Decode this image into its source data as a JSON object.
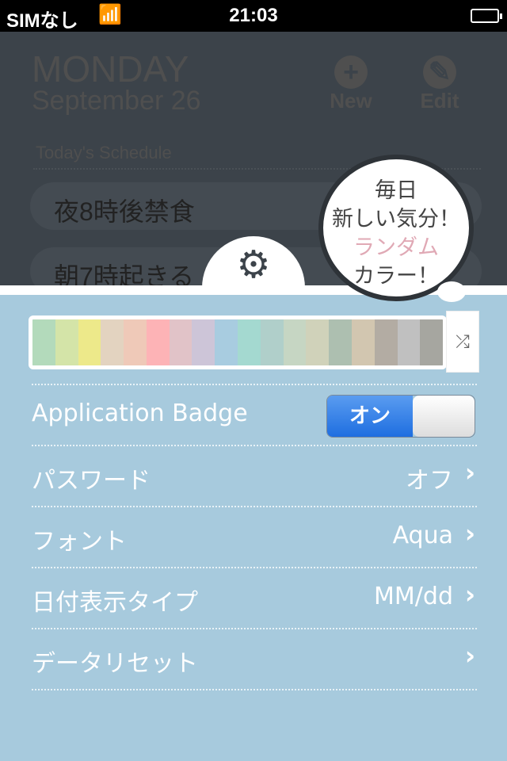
{
  "status_bar": {
    "carrier": "SIMなし",
    "time": "21:03",
    "wifi_icon": "wifi-icon",
    "battery_icon": "battery-charging-icon"
  },
  "header": {
    "day": "MONDAY",
    "date": "September  26",
    "new_label": "New",
    "edit_label": "Edit"
  },
  "schedule": {
    "title": "Today's Schedule",
    "items": [
      "夜8時後禁食",
      "朝7時起きる"
    ]
  },
  "bubble": {
    "line1": "毎日",
    "line2": "新しい気分！",
    "line3": "ランダム",
    "line4": "カラー！"
  },
  "palette": {
    "colors": [
      "#b3dabb",
      "#d4e4a8",
      "#ede98a",
      "#e3d3c0",
      "#efc9b8",
      "#fdb3b6",
      "#e1c3c8",
      "#cdc5d8",
      "#a8cce0",
      "#a4d9d0",
      "#b0cfca",
      "#c6d6c3",
      "#d0d2ba",
      "#adbfb0",
      "#d2c6b0",
      "#b3aca3",
      "#c0c0c0",
      "#a6a6a0"
    ]
  },
  "settings": [
    {
      "label": "Application Badge",
      "toggle": "オン",
      "toggle_on": true
    },
    {
      "label": "パスワード",
      "value": "オフ"
    },
    {
      "label": "フォント",
      "value": "Aqua"
    },
    {
      "label": "日付表示タイプ",
      "value": "MM/dd"
    },
    {
      "label": "データリセット",
      "value": ""
    }
  ],
  "colors": {
    "panel": "#a7cadd",
    "overlay": "#3c434a",
    "toggle_on": "#2a78e4"
  }
}
